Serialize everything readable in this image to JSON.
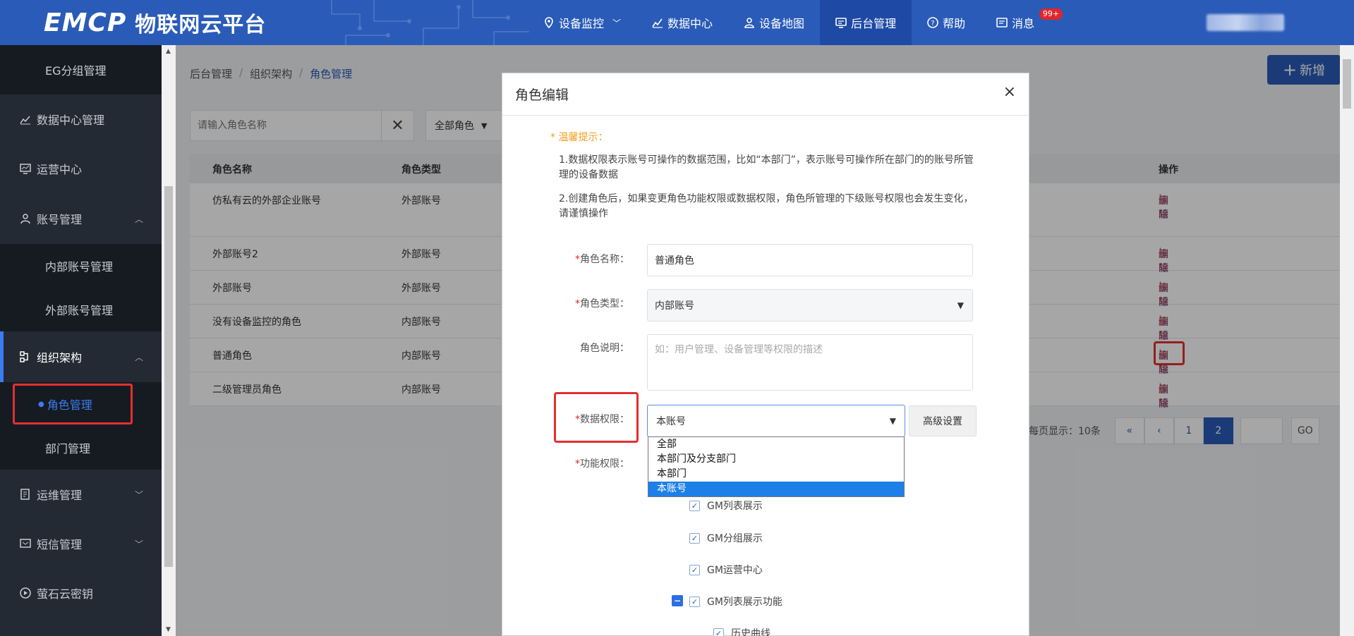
{
  "topbar": {
    "logo_mark": "EMCP",
    "logo_text": "物联网云平台",
    "nav": [
      {
        "label": "设备监控",
        "icon": "location-pin-icon"
      },
      {
        "label": "数据中心",
        "icon": "chart-icon"
      },
      {
        "label": "设备地图",
        "icon": "user-pin-icon"
      },
      {
        "label": "后台管理",
        "icon": "monitor-icon"
      },
      {
        "label": "帮助",
        "icon": "help-icon"
      },
      {
        "label": "消息",
        "icon": "message-icon",
        "badge": "99+"
      }
    ],
    "active_nav": "后台管理"
  },
  "sidebar": {
    "items": [
      {
        "label": "EG分组管理",
        "type": "sub"
      },
      {
        "label": "数据中心管理",
        "icon": "chart-icon"
      },
      {
        "label": "运营中心",
        "icon": "monitor-chart-icon"
      },
      {
        "label": "账号管理",
        "icon": "user-icon",
        "expanded": true
      },
      {
        "label": "内部账号管理",
        "type": "sub"
      },
      {
        "label": "外部账号管理",
        "type": "sub"
      },
      {
        "label": "组织架构",
        "icon": "org-icon",
        "expanded": true
      },
      {
        "label": "角色管理",
        "type": "sub",
        "active": true
      },
      {
        "label": "部门管理",
        "type": "sub"
      },
      {
        "label": "运维管理",
        "icon": "doc-icon"
      },
      {
        "label": "短信管理",
        "icon": "sms-icon"
      },
      {
        "label": "萤石云密钥",
        "icon": "play-circle-icon"
      }
    ]
  },
  "breadcrumb": [
    "后台管理",
    "组织架构",
    "角色管理"
  ],
  "toolbar": {
    "search_placeholder": "请输入角色名称",
    "role_filter": "全部角色",
    "add_label": "新增"
  },
  "table": {
    "columns": [
      "角色名称",
      "角色类型",
      "操作"
    ],
    "rows": [
      {
        "name": "仿私有云的外部企业账号",
        "type": "外部账号"
      },
      {
        "name": "外部账号2",
        "type": "外部账号"
      },
      {
        "name": "外部账号",
        "type": "外部账号"
      },
      {
        "name": "没有设备监控的角色",
        "type": "内部账号"
      },
      {
        "name": "普通角色",
        "type": "内部账号"
      },
      {
        "name": "二级管理员角色",
        "type": "内部账号"
      }
    ],
    "edit_label": "编辑",
    "delete_label": "删除",
    "op_sep": "|"
  },
  "pager": {
    "info": "，每页显示：10条",
    "prev_prev": "«",
    "prev": "‹",
    "pages": [
      "1",
      "2"
    ],
    "current_page": "2",
    "go": "GO"
  },
  "modal": {
    "title": "角色编辑",
    "close": "×",
    "tip_title": "* 温馨提示：",
    "tips": [
      "1.数据权限表示账号可操作的数据范围，比如“本部门”，表示账号可操作所在部门的的账号所管理的设备数据",
      "2.创建角色后，如果变更角色功能权限或数据权限，角色所管理的下级账号权限也会发生变化，请谨慎操作"
    ],
    "fields": {
      "name_label": "角色名称：",
      "name_value": "普通角色",
      "type_label": "角色类型：",
      "type_value": "内部账号",
      "desc_label": "角色说明：",
      "desc_placeholder": "如：用户管理、设备管理等权限的描述",
      "data_label": "数据权限：",
      "data_value": "本账号",
      "adv_label": "高级设置",
      "func_label": "功能权限："
    },
    "data_options": [
      "全部",
      "本部门及分支部门",
      "本部门",
      "本账号"
    ],
    "data_selected": "本账号",
    "permissions": [
      {
        "label": "GM列表展示",
        "checked": true
      },
      {
        "label": "GM分组展示",
        "checked": true
      },
      {
        "label": "GM运营中心",
        "checked": true
      },
      {
        "label": "GM列表展示功能",
        "checked": true,
        "expanded": true
      },
      {
        "label": "历史曲线",
        "checked": true
      }
    ],
    "required_mark": "*"
  },
  "colors": {
    "topbar": "#2a5bb8",
    "sidebar": "#232a34",
    "accent": "#2a5bb8",
    "highlight": "#e23030",
    "delete": "#d0302f"
  }
}
